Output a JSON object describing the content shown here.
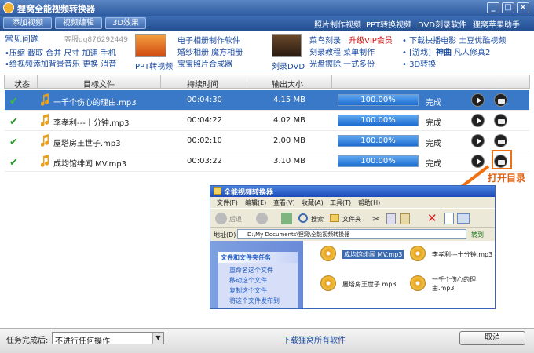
{
  "window": {
    "title": "狸窝全能视频转换器"
  },
  "menu": {
    "tabs": [
      "添加视频",
      "视频编辑",
      "3D效果"
    ],
    "links": [
      "照片制作视频",
      "PPT转换视频",
      "DVD刻录软件",
      "狸窝苹果助手"
    ]
  },
  "ads": {
    "faq_title": "常见问题",
    "qq": "客服qq876292449",
    "faq_line1": "•压缩 截取 合并 尺寸 加速 手机",
    "faq_line2": "•给视频添加背景音乐 更换 消音",
    "ppt_label": "PPT转视频",
    "ad1": "电子相册制作软件",
    "ad2": "婚纱相册 魔方相册",
    "ad3": "宝宝照片合成器",
    "dvd_label": "刻录DVD",
    "ad4a": "菜鸟刻录",
    "ad4b": "升级VIP会员",
    "ad5": "刻录教程 菜单制作",
    "ad6": "光盘擦除 一式多份",
    "ad7": "• 下载抉播电影 土豆优酷视频",
    "ad8a": "• [游戏] ",
    "ad8b": "神曲",
    "ad8c": " 凡人修真2",
    "ad9": "• 3D转换"
  },
  "table": {
    "headers": [
      "状态",
      "目标文件",
      "持续时间",
      "输出大小"
    ],
    "rows": [
      {
        "file": "一千个伤心的理由.mp3",
        "duration": "00:04:30",
        "size": "4.15 MB",
        "progress": "100.00%",
        "status": "完成",
        "selected": true
      },
      {
        "file": "李孝利---十分钟.mp3",
        "duration": "00:04:22",
        "size": "4.02 MB",
        "progress": "100.00%",
        "status": "完成",
        "selected": false
      },
      {
        "file": "屋塔房王世子.mp3",
        "duration": "00:02:10",
        "size": "2.00 MB",
        "progress": "100.00%",
        "status": "完成",
        "selected": false
      },
      {
        "file": "成均馆绯闻 MV.mp3",
        "duration": "00:03:22",
        "size": "3.10 MB",
        "progress": "100.00%",
        "status": "完成",
        "selected": false
      }
    ]
  },
  "callout": "打开目录",
  "explorer": {
    "title": "全能视频转换器",
    "menu": [
      "文件(F)",
      "编辑(E)",
      "查看(V)",
      "收藏(A)",
      "工具(T)",
      "帮助(H)"
    ],
    "back": "后退",
    "search": "搜索",
    "folders": "文件夹",
    "address_label": "地址(D)",
    "address": "D:\\My Documents\\狸窝\\全能视频转换器",
    "go": "转到",
    "tasks_title": "文件和文件夹任务",
    "tasks": [
      "重命名这个文件",
      "移动这个文件",
      "复制这个文件",
      "将这个文件发布到"
    ],
    "files": [
      "成均馆绯闻 MV.mp3",
      "李孝利---十分钟.mp3",
      "屋塔房王世子.mp3",
      "一千个伤心的理由.mp3"
    ]
  },
  "bottom": {
    "after_label": "任务完成后:",
    "after_value": "不进行任何操作",
    "download": "下载狸窝所有软件",
    "cancel": "取消"
  },
  "colors": {
    "accent": "#3a78c8",
    "progress": "#1c6cd0",
    "highlight": "#f07010"
  }
}
